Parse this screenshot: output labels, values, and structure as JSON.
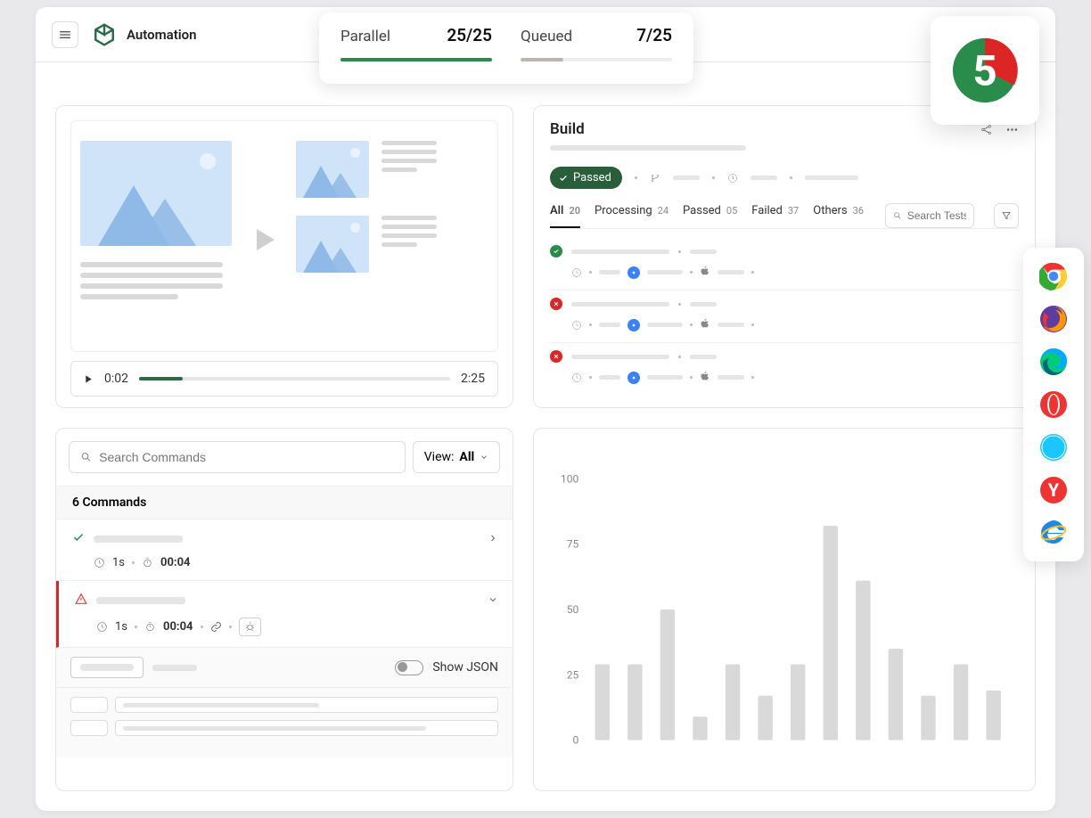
{
  "header": {
    "app_title": "Automation"
  },
  "status": {
    "parallel": {
      "label": "Parallel",
      "value": "25/25",
      "color": "#2a8c4a",
      "fill_pct": 100
    },
    "queued": {
      "label": "Queued",
      "value": "7/25",
      "color": "#c0b4b0",
      "fill_pct": 28
    }
  },
  "step_badge": {
    "number": "5",
    "fg": "#ffffff",
    "ring_primary": "#2a8c4a",
    "ring_accent": "#dc2626"
  },
  "video": {
    "current_time": "0:02",
    "total_time": "2:25",
    "progress_pct": 14
  },
  "build": {
    "title": "Build",
    "status_label": "Passed",
    "tabs": [
      {
        "label": "All",
        "count": "20",
        "active": true
      },
      {
        "label": "Processing",
        "count": "24",
        "active": false
      },
      {
        "label": "Passed",
        "count": "05",
        "active": false
      },
      {
        "label": "Failed",
        "count": "37",
        "active": false
      },
      {
        "label": "Others",
        "count": "36",
        "active": false
      }
    ],
    "search_placeholder": "Search Tests",
    "tests": [
      {
        "status": "pass"
      },
      {
        "status": "fail"
      },
      {
        "status": "fail"
      },
      {
        "status": "pass"
      }
    ]
  },
  "commands": {
    "search_placeholder": "Search Commands",
    "view_label": "View:",
    "view_value": "All",
    "count_label": "6 Commands",
    "items": [
      {
        "status": "pass",
        "duration": "1s",
        "time": "00:04"
      },
      {
        "status": "error",
        "duration": "1s",
        "time": "00:04"
      }
    ],
    "json_toggle_label": "Show JSON"
  },
  "chart_data": {
    "type": "bar",
    "ylim": [
      0,
      100
    ],
    "yticks": [
      0,
      25,
      50,
      75,
      100
    ],
    "values": [
      29,
      29,
      50,
      9,
      29,
      17,
      29,
      82,
      61,
      35,
      17,
      29,
      19
    ],
    "bar_color": "#d9d9d9"
  },
  "browsers": [
    "chrome",
    "firefox",
    "edge",
    "opera",
    "safari",
    "yandex",
    "ie"
  ]
}
